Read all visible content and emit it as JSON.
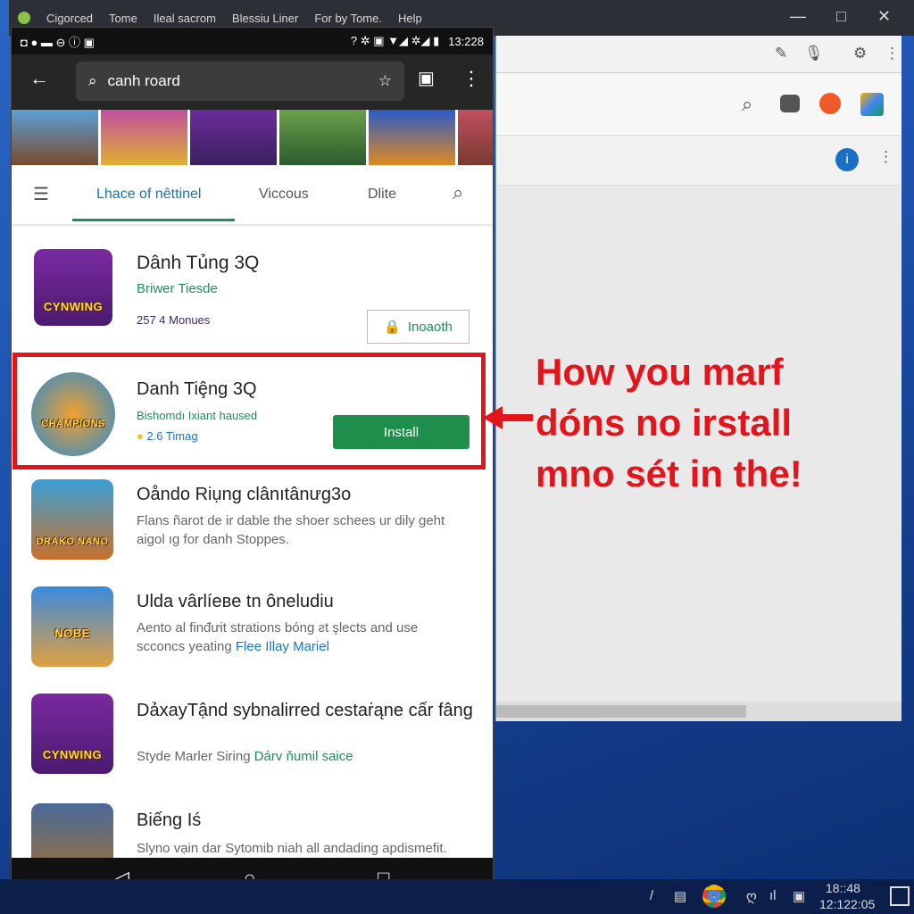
{
  "desktop": {
    "menu": [
      "Cigorced",
      "Tome",
      "Ileal sacrom",
      "Blessiu Liner",
      "For by Tome.",
      "Help"
    ],
    "window_controls": [
      "—",
      "□",
      "✕"
    ]
  },
  "phone": {
    "status_time": "13:228",
    "search": {
      "value": "canh roard"
    },
    "tabs": [
      {
        "label": "Lhace of nêttinel",
        "active": true
      },
      {
        "label": "Viccous"
      },
      {
        "label": "Dlite"
      }
    ],
    "apps": [
      {
        "title": "Dânh Tủng 3Q",
        "subtitle": "Briwer Tiesde",
        "meta": "257 4 Monues",
        "button": "Inoaoth",
        "icon_text": "CYNWING"
      },
      {
        "title": "Danh Tiȩ̂ng 3Q",
        "subtitle": "Bishomdı Ixiant haused",
        "meta": "2.6 Timag",
        "button": "Install",
        "icon_text": "CHAMPIONS"
      },
      {
        "title": "Oåndo Riụng clânıtânưg3o",
        "desc": "Flans ñarot de ir dable the shoer schees ur dily geht aigol ıg for danh Stoppes.",
        "icon_text": "DRAKO NANO"
      },
      {
        "title": "Ulda vârlíeвe tn ôneludiu",
        "desc": "Aento al finđưit strations bóng ƨt şlects and use scconcs yeating ",
        "link": "Flee Illay Mariel",
        "icon_text": "NOBE"
      },
      {
        "title": "DảxayTậnd sybnalirred cestaṙąne cấr fâng",
        "desc": "Styde Marler Siring ",
        "link": "Dárv ňumil saice",
        "icon_text": "CYNWING"
      },
      {
        "title": "Biếng Iś",
        "desc": "Slyno vạin dar Sytomib niah all andading apdismefit.",
        "icon_text": ""
      }
    ]
  },
  "annotation": {
    "lines": [
      "How you marf",
      "dóns no irstall",
      "mno sét in the!"
    ],
    "color": "#e3141b"
  },
  "taskbar": {
    "time": "18::48",
    "date": "12:122:05"
  },
  "colors": {
    "install_green": "#1e8e5a",
    "highlight_red": "#e3141b"
  }
}
